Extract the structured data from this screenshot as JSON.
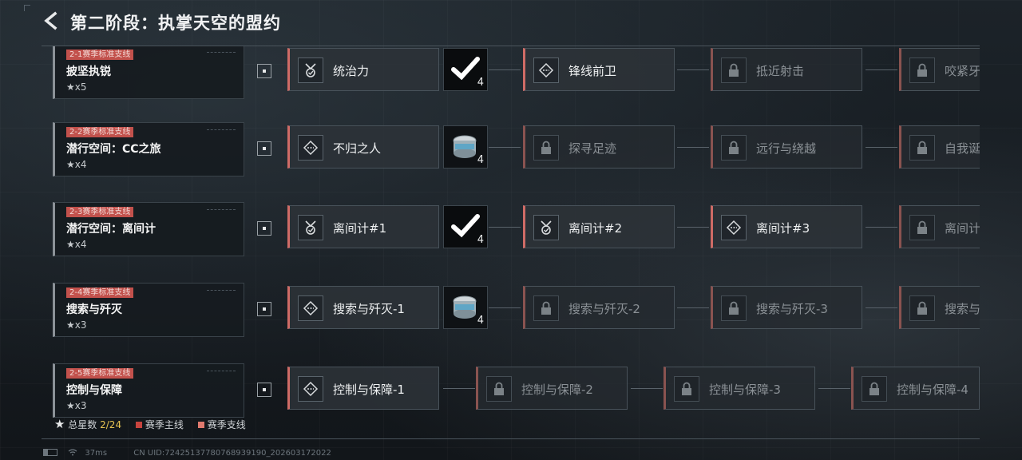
{
  "header": {
    "title": "第二阶段：执掌天空的盟约"
  },
  "legend": {
    "total_label": "总星数",
    "total_value": "2/24",
    "main_label": "赛季主线",
    "branch_label": "赛季支线",
    "main_color": "#c7443e",
    "branch_color": "#e07a6e"
  },
  "status": {
    "latency": "37ms",
    "uid": "CN UID:7242513778076893919​0_202603172022"
  },
  "rows": [
    {
      "tag": "2-1赛季标准支线",
      "name": "披坚执锐",
      "stars": "x5",
      "m1": "统治力",
      "m1_icon": "medal-icon",
      "reward": "4",
      "reward_state": "claimed",
      "m2": "锋线前卫",
      "m3": "抵近射击",
      "m4": "咬紧牙"
    },
    {
      "tag": "2-2赛季标准支线",
      "name": "潜行空间：CC之旅",
      "stars": "x4",
      "m1": "不归之人",
      "m1_icon": "target-icon",
      "reward": "4",
      "reward_state": "available",
      "m2": "探寻足迹",
      "m3": "远行与绕越",
      "m4": "自我诞"
    },
    {
      "tag": "2-3赛季标准支线",
      "name": "潜行空间：离间计",
      "stars": "x4",
      "m1": "离间计#1",
      "m1_icon": "medal-icon",
      "reward": "4",
      "reward_state": "claimed",
      "m2": "离间计#2",
      "m3": "离间计#3",
      "m4": "离间计"
    },
    {
      "tag": "2-4赛季标准支线",
      "name": "搜索与歼灭",
      "stars": "x3",
      "m1": "搜索与歼灭-1",
      "m1_icon": "target-icon",
      "reward": "4",
      "reward_state": "available",
      "m2": "搜索与歼灭-2",
      "m3": "搜索与歼灭-3",
      "m4": "搜索与"
    },
    {
      "tag": "2-5赛季标准支线",
      "name": "控制与保障",
      "stars": "x3",
      "m1": "控制与保障-1",
      "m1_icon": "target-icon",
      "m2": "控制与保障-2",
      "m3": "控制与保障-3",
      "m4": "控制与保障-4"
    }
  ]
}
